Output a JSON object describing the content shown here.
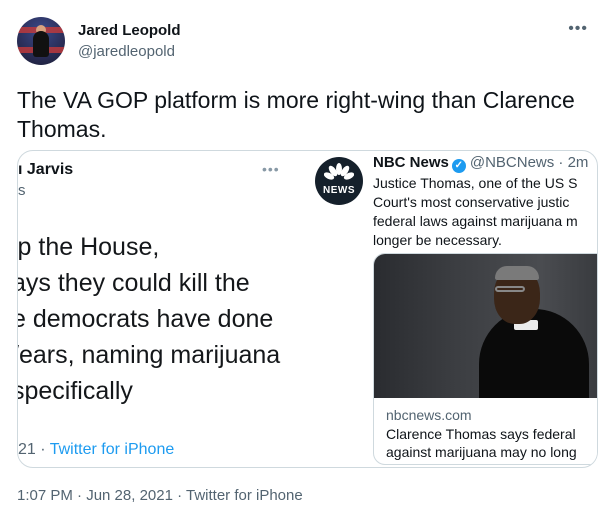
{
  "tweet": {
    "author_name": "Jared Leopold",
    "author_handle": "@jaredleopold",
    "more_icon": "more-horizontal-icon",
    "text": "The VA GOP platform is more right-wing than Clarence Thomas.",
    "timestamp": "1:07 PM · Jun 28, 2021 · Twitter for iPhone"
  },
  "left_card": {
    "name": "ı Jarvis",
    "handle": "s",
    "lines": [
      "ip the House,",
      "ays they could kill the",
      "e democrats have done",
      "/ears, naming marijuana",
      "specifically"
    ],
    "footer_prefix": "21 · ",
    "footer_link": "Twitter for iPhone"
  },
  "right_card": {
    "avatar_label": "NEWS",
    "name": "NBC News",
    "handle": "@NBCNews · 2m",
    "text_lines": [
      "Justice Thomas, one of the US S",
      "Court's most conservative justic",
      "federal laws against marijuana m",
      "longer be necessary."
    ],
    "link_domain": "nbcnews.com",
    "link_title_lines": [
      "Clarence Thomas says federal",
      "against marijuana may no long"
    ]
  },
  "colors": {
    "accent": "#1d9bf0",
    "text": "#0f1419",
    "muted": "#536471",
    "border": "#cfd9de"
  }
}
